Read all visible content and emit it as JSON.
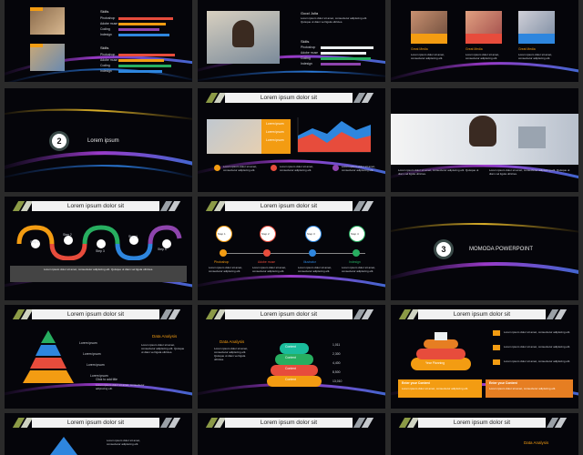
{
  "header_title": "Lorem ipsum dolor sit",
  "body_text": "Lorem ipsum dolor sit amet, consectetur adipiscing elit. Quisque ut diam vel ligula ultricies.",
  "short_text": "Lorem ipsum dolor sit amet, consectetur adipiscing elit.",
  "tiny_text": "Lorem ipsum dolor sit amet, consectetur adipiscing elit.",
  "row1": {
    "s1": {
      "skills_a": "Skills",
      "skills_b": "Skills",
      "items": [
        "Photoshop",
        "Adobe muse",
        "Coding",
        "Indesign"
      ]
    },
    "s2": {
      "name": "Good Julia",
      "skills": "Skills",
      "items": [
        "Photoshop",
        "Adobe muse",
        "Coding",
        "Indesign"
      ]
    },
    "s3": {
      "cards": [
        "Great Media",
        "Great Media",
        "Great Media"
      ]
    }
  },
  "row2": {
    "s1": {
      "num": "2",
      "title": "Lorem ipsum"
    },
    "s2": {
      "legend": [
        "Lorem ipsum",
        "Lorem ipsum",
        "Lorem ipsum"
      ]
    },
    "s3": {}
  },
  "row3": {
    "s1": {
      "steps": [
        "Step 1",
        "Step 2",
        "Step 3",
        "Step 4",
        "Step 5"
      ]
    },
    "s2": {
      "steps": [
        "Step 1",
        "Step 2",
        "Step 3",
        "Step 4"
      ],
      "labels": [
        "Photoshop",
        "Adobe muse",
        "Illustrator",
        "Indesign"
      ]
    },
    "s3": {
      "num": "3",
      "title": "MOMODA POWERPOINT"
    }
  },
  "row4": {
    "s1": {
      "title": "Data Analysis",
      "layers": [
        "Lorem ipsum",
        "Lorem ipsum",
        "Lorem ipsum",
        "Lorem ipsum"
      ],
      "side": "Click to add title"
    },
    "s2": {
      "title": "Data Analysis",
      "layers": [
        "Content",
        "Content",
        "Content",
        "Content"
      ],
      "values": [
        "1,011",
        "2,300",
        "4,400",
        "8,500",
        "13,010"
      ]
    },
    "s3": {
      "label": "Year Planning",
      "box_a": "Enter your Content",
      "box_b": "Enter your Content"
    }
  },
  "colors": {
    "orange": "#f39c12",
    "red": "#e74c3c",
    "green": "#27ae60",
    "purple": "#8e44ad",
    "blue": "#2e86de",
    "teal": "#1abc9c"
  }
}
